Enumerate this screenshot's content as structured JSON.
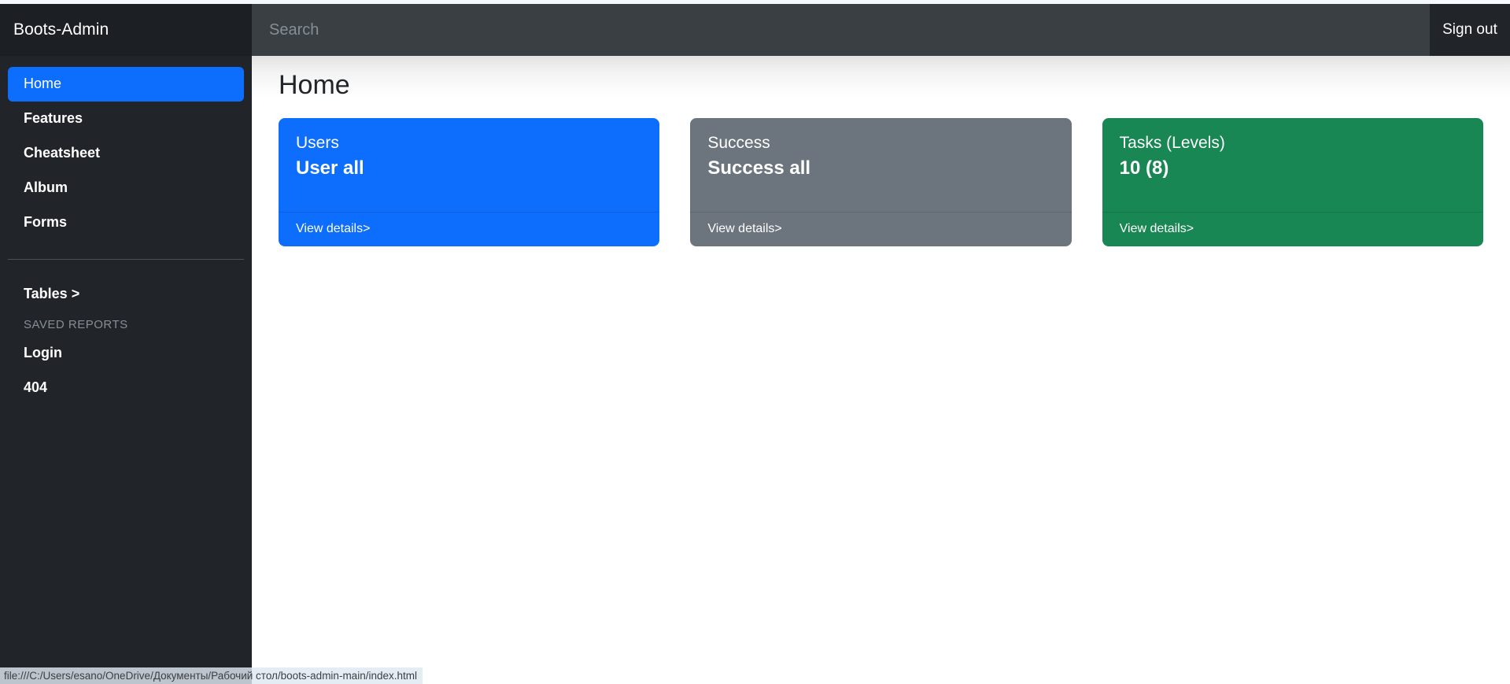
{
  "topbar": {
    "brand": "Boots-Admin",
    "search": {
      "placeholder": "Search",
      "value": ""
    },
    "signout_label": "Sign out"
  },
  "sidebar": {
    "items": [
      {
        "label": "Home",
        "active": true
      },
      {
        "label": "Features",
        "active": false
      },
      {
        "label": "Cheatsheet",
        "active": false
      },
      {
        "label": "Album",
        "active": false
      },
      {
        "label": "Forms",
        "active": false
      }
    ],
    "tables_label": "Tables >",
    "section_label": "SAVED REPORTS",
    "reports": [
      {
        "label": "Login"
      },
      {
        "label": "404"
      }
    ]
  },
  "main": {
    "page_title": "Home",
    "cards": [
      {
        "label": "Users",
        "value": "User all",
        "footer_link": "View details>",
        "color": "#0d6efd",
        "variant": "blue"
      },
      {
        "label": "Success",
        "value": "Success all",
        "footer_link": "View details>",
        "color": "#6c757d",
        "variant": "gray"
      },
      {
        "label": "Tasks (Levels)",
        "value": "10 (8)",
        "footer_link": "View details>",
        "color": "#198754",
        "variant": "green"
      }
    ]
  },
  "statusbar": {
    "url": "file:///C:/Users/esano/OneDrive/Документы/Рабочий стол/boots-admin-main/index.html"
  }
}
